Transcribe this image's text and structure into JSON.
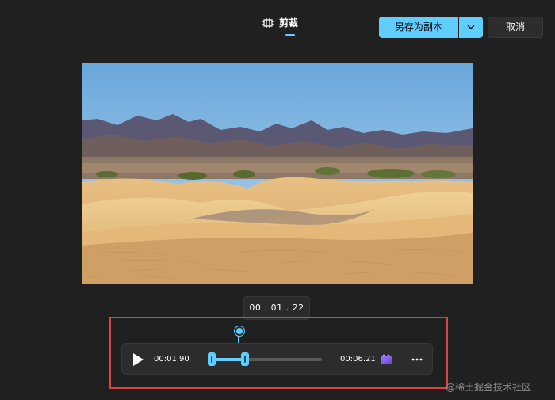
{
  "header": {
    "tab_label": "剪裁",
    "tab_icon": "trim-icon"
  },
  "toolbar": {
    "save_label": "另存为副本",
    "save_dropdown_icon": "chevron-down-icon",
    "cancel_label": "取消"
  },
  "preview": {
    "description": "desert-dunes-image"
  },
  "timecode": "00 : 01 . 22",
  "trim_controls": {
    "start_time": "00:01.90",
    "end_time": "00:06.21",
    "play_icon": "play-icon",
    "clip_icon": "clip-icon",
    "more_icon": "more-icon",
    "selection": {
      "start_fraction": 0.03,
      "end_fraction": 0.32
    },
    "playhead_fraction": 0.3
  },
  "watermark": "@稀土掘金技术社区",
  "colors": {
    "accent": "#60cdff",
    "background": "#202020",
    "highlight_border": "#e04040"
  }
}
